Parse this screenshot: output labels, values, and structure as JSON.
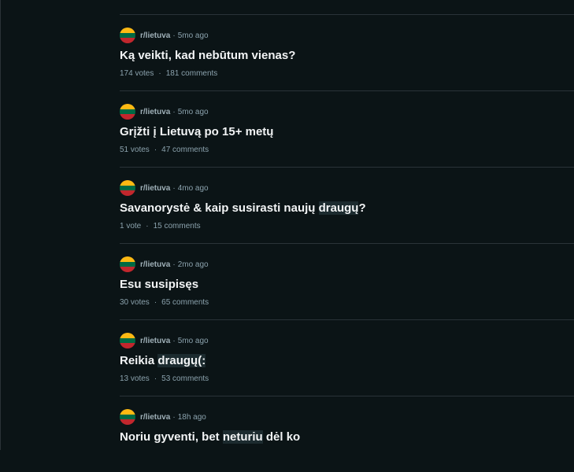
{
  "posts": [
    {
      "subreddit": "r/lietuva",
      "age": "5mo ago",
      "title_parts": [
        "Ką veikti, kad nebūtum vienas?",
        "",
        ""
      ],
      "votes": "174 votes",
      "comments": "181 comments"
    },
    {
      "subreddit": "r/lietuva",
      "age": "5mo ago",
      "title_parts": [
        "Grįžti į Lietuvą po 15+ metų",
        "",
        ""
      ],
      "votes": "51 votes",
      "comments": "47 comments"
    },
    {
      "subreddit": "r/lietuva",
      "age": "4mo ago",
      "title_parts": [
        "Savanorystė & kaip susirasti naujų ",
        "draugų",
        "?"
      ],
      "votes": "1 vote",
      "comments": "15 comments"
    },
    {
      "subreddit": "r/lietuva",
      "age": "2mo ago",
      "title_parts": [
        "Esu susipisęs",
        "",
        ""
      ],
      "votes": "30 votes",
      "comments": "65 comments"
    },
    {
      "subreddit": "r/lietuva",
      "age": "5mo ago",
      "title_parts": [
        "Reikia ",
        "draugų(:",
        ""
      ],
      "votes": "13 votes",
      "comments": "53 comments"
    },
    {
      "subreddit": "r/lietuva",
      "age": "18h ago",
      "title_parts": [
        "Noriu gyventi, bet ",
        "neturiu",
        " dėl ko"
      ],
      "votes": "",
      "comments": ""
    }
  ],
  "separator": "·",
  "colors": {
    "background": "#0b1416",
    "divider": "#2a3338",
    "meta": "#8ba2ad",
    "highlight": "#1c2b2f"
  },
  "icons": {
    "subreddit_avatar": "lithuania-flag-icon"
  }
}
